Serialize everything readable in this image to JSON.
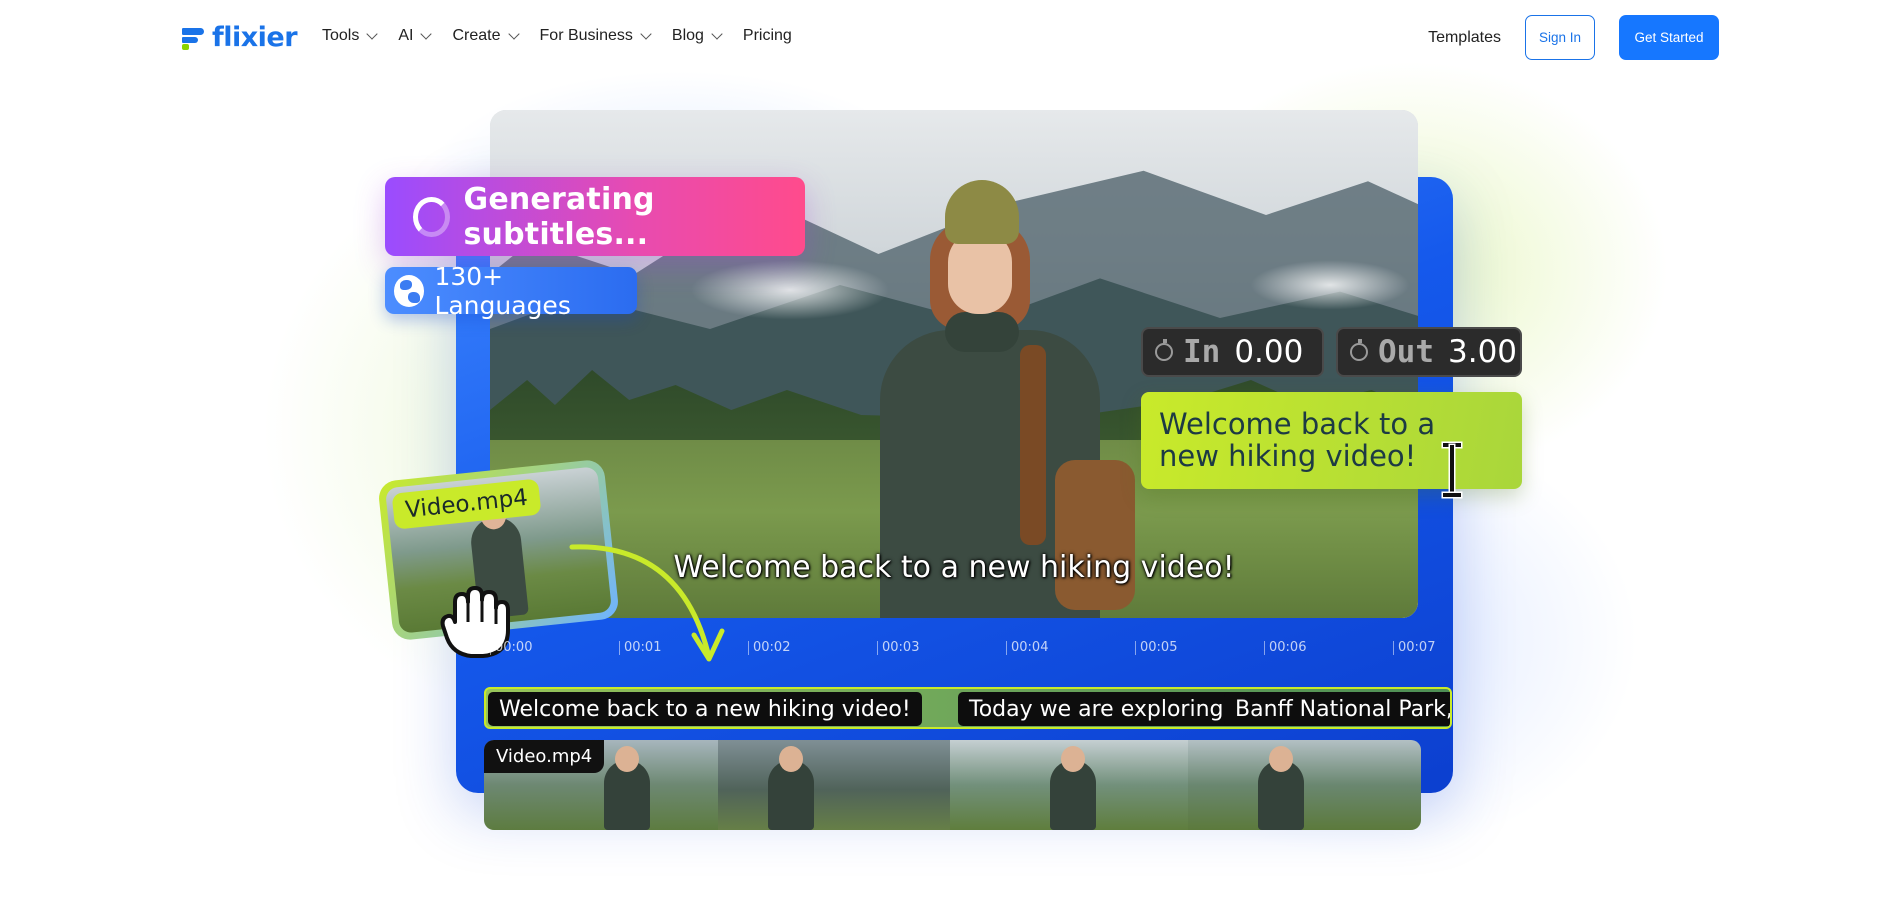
{
  "brand": {
    "name": "flixier",
    "color": "#1a73e8",
    "accent": "#8bd400"
  },
  "nav": {
    "items": [
      {
        "label": "Tools",
        "has_dropdown": true
      },
      {
        "label": "AI",
        "has_dropdown": true
      },
      {
        "label": "Create",
        "has_dropdown": true
      },
      {
        "label": "For Business",
        "has_dropdown": true
      },
      {
        "label": "Blog",
        "has_dropdown": true
      },
      {
        "label": "Pricing",
        "has_dropdown": false
      }
    ],
    "templates_label": "Templates",
    "signin_label": "Sign In",
    "get_started_label": "Get Started"
  },
  "hero": {
    "generating_label": "Generating subtitles...",
    "languages_label": "130+ Languages",
    "video_caption": "Welcome back to a new hiking video!",
    "time_in_label": "In",
    "time_in_value": "0.00",
    "time_out_label": "Out",
    "time_out_value": "3.00",
    "edit_text": "Welcome back to a new hiking video!",
    "video_card_label": "Video.mp4"
  },
  "timeline": {
    "ticks": [
      "00:00",
      "00:01",
      "00:02",
      "00:03",
      "00:04",
      "00:05",
      "00:06",
      "00:07"
    ],
    "subtitles": [
      "Welcome back to a new hiking video!",
      "Today we are exploring",
      "Banff National Park, C"
    ],
    "film_label": "Video.mp4"
  },
  "colors": {
    "primary_button": "#1677ff",
    "panel_blue": "#1559ec",
    "generating_gradient": [
      "#9a4cff",
      "#ff4b8c"
    ],
    "subtitle_highlight": "#c9ea2a"
  }
}
